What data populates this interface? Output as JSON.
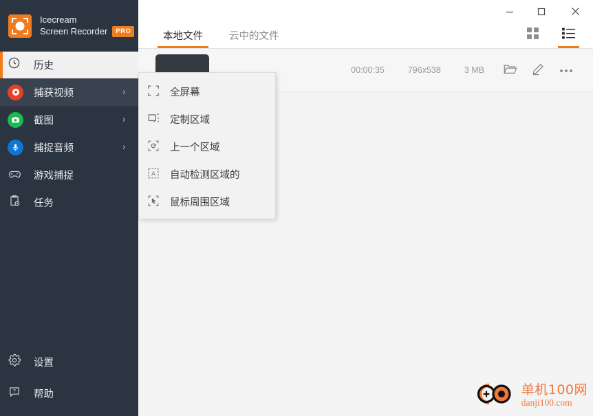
{
  "app": {
    "brand_line1": "Icecream",
    "brand_line2": "Screen Recorder",
    "pro_badge": "PRO",
    "accent_color": "#ee7c16",
    "sidebar_color": "#2b3441"
  },
  "window_controls": {
    "minimize": "minimize-icon",
    "maximize": "maximize-icon",
    "close": "close-icon"
  },
  "sidebar": {
    "items": [
      {
        "label": "历史",
        "icon": "clock-icon",
        "state": "selected",
        "chevron": ""
      },
      {
        "label": "捕获视频",
        "icon": "record-circle-icon",
        "state": "active",
        "chevron": "›"
      },
      {
        "label": "截图",
        "icon": "camera-circle-icon",
        "state": "normal",
        "chevron": "›"
      },
      {
        "label": "捕捉音频",
        "icon": "microphone-circle-icon",
        "state": "normal",
        "chevron": "›"
      },
      {
        "label": "游戏捕捉",
        "icon": "gamepad-icon",
        "state": "normal",
        "chevron": ""
      },
      {
        "label": "任务",
        "icon": "clipboard-clock-icon",
        "state": "normal",
        "chevron": ""
      }
    ],
    "bottom_items": [
      {
        "label": "设置",
        "icon": "gear-icon"
      },
      {
        "label": "帮助",
        "icon": "help-balloon-icon"
      }
    ]
  },
  "tabs": [
    {
      "label": "本地文件",
      "active": true
    },
    {
      "label": "云中的文件",
      "active": false
    }
  ],
  "view_toggles": [
    {
      "name": "grid-view",
      "icon": "grid-icon",
      "active": false
    },
    {
      "name": "list-view",
      "icon": "list-icon",
      "active": true
    }
  ],
  "file_row": {
    "duration": "00:00:35",
    "resolution": "796x538",
    "size": "3 MB",
    "actions": [
      {
        "name": "open-folder",
        "icon": "folder-icon"
      },
      {
        "name": "edit",
        "icon": "pencil-icon"
      },
      {
        "name": "more-options",
        "icon": "more-dots-icon"
      }
    ]
  },
  "menu": {
    "items": [
      {
        "label": "全屏幕",
        "icon": "fullscreen-brackets-icon"
      },
      {
        "label": "定制区域",
        "icon": "custom-area-icon"
      },
      {
        "label": "上一个区域",
        "icon": "last-area-refresh-icon"
      },
      {
        "label": "自动检测区域的",
        "icon": "auto-detect-area-icon"
      },
      {
        "label": "鼠标周围区域",
        "icon": "area-around-mouse-icon"
      }
    ]
  },
  "watermark": {
    "line1": "单机100网",
    "line2": "danji100.com"
  }
}
